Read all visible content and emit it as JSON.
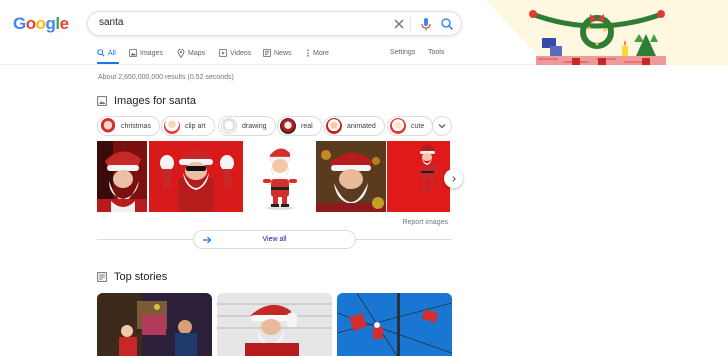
{
  "logo": {
    "letters": [
      "G",
      "o",
      "o",
      "g",
      "l",
      "e"
    ]
  },
  "search": {
    "query": "santa"
  },
  "tabs": [
    {
      "label": "All",
      "icon": "search-icon"
    },
    {
      "label": "Images",
      "icon": "image-icon"
    },
    {
      "label": "Maps",
      "icon": "map-pin-icon"
    },
    {
      "label": "Videos",
      "icon": "play-icon"
    },
    {
      "label": "News",
      "icon": "news-icon"
    },
    {
      "label": "More",
      "icon": "more-vertical-icon"
    }
  ],
  "tools": {
    "settings": "Settings",
    "tools": "Tools"
  },
  "results": {
    "stats": "About 2,650,000,000 results (0.52 seconds)"
  },
  "images_section": {
    "title": "Images for santa",
    "chips": [
      "christmas",
      "clip art",
      "drawing",
      "real",
      "animated",
      "cute"
    ],
    "report": "Report images",
    "view_all": "View all"
  },
  "top_stories": {
    "title": "Top stories"
  },
  "colors": {
    "accent": "#1a73e8",
    "link": "#1a0dab",
    "logo_blue": "#4285f4",
    "logo_red": "#ea4335",
    "logo_yellow": "#fbbc05",
    "logo_green": "#34a853",
    "santa_red": "#d0021b"
  }
}
